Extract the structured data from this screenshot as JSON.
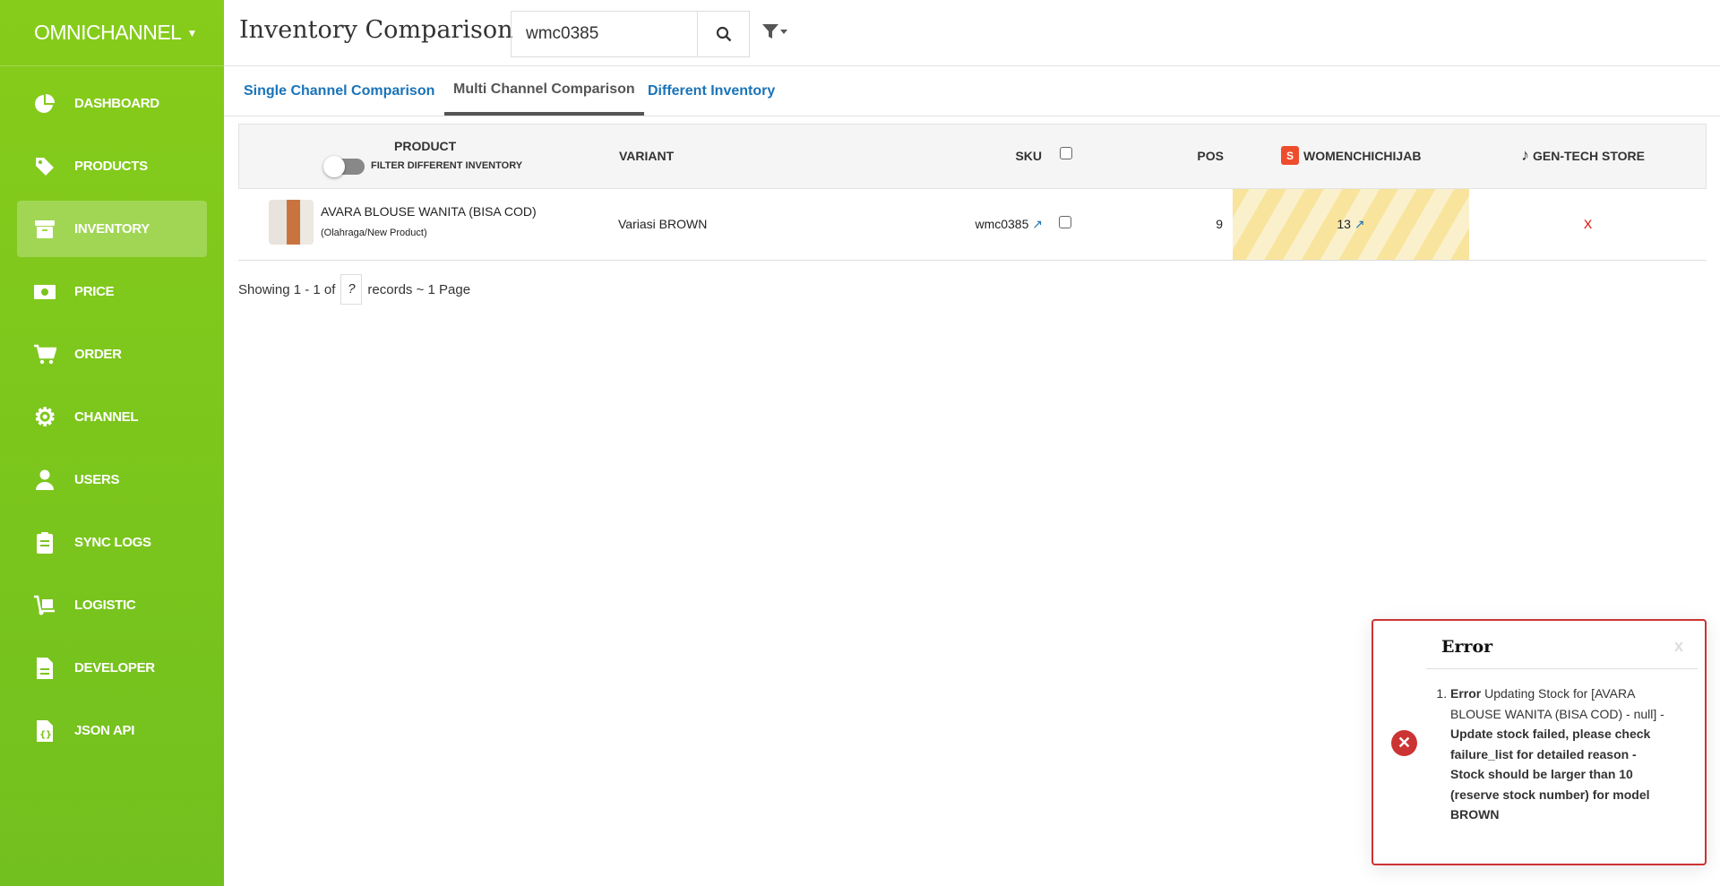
{
  "brand": {
    "label": "OMNICHANNEL"
  },
  "sidebar": {
    "items": [
      {
        "label": "DASHBOARD",
        "icon": "pie-chart-icon"
      },
      {
        "label": "PRODUCTS",
        "icon": "tag-icon"
      },
      {
        "label": "INVENTORY",
        "icon": "archive-icon",
        "active": true
      },
      {
        "label": "PRICE",
        "icon": "money-icon"
      },
      {
        "label": "ORDER",
        "icon": "cart-icon"
      },
      {
        "label": "CHANNEL",
        "icon": "gear-icon"
      },
      {
        "label": "USERS",
        "icon": "user-icon"
      },
      {
        "label": "SYNC LOGS",
        "icon": "clipboard-icon"
      },
      {
        "label": "LOGISTIC",
        "icon": "dolly-icon"
      },
      {
        "label": "DEVELOPER",
        "icon": "file-icon"
      },
      {
        "label": "JSON API",
        "icon": "json-file-icon"
      }
    ]
  },
  "header": {
    "title": "Inventory Comparison",
    "search_value": "wmc0385"
  },
  "tabs": [
    {
      "label": "Single Channel Comparison"
    },
    {
      "label": "Multi Channel Comparison",
      "active": true
    },
    {
      "label": "Different Inventory"
    }
  ],
  "table": {
    "headers": {
      "product": "PRODUCT",
      "filter_label": "FILTER DIFFERENT INVENTORY",
      "variant": "VARIANT",
      "sku": "SKU",
      "pos": "POS",
      "channel1": "WOMENCHICHIJAB",
      "channel2": "GEN-TECH STORE"
    },
    "rows": [
      {
        "name": "AVARA BLOUSE WANITA (BISA COD)",
        "category": "(Olahraga/New Product)",
        "variant": "Variasi BROWN",
        "sku": "wmc0385",
        "pos": "9",
        "channel1": "13",
        "channel2": "X"
      }
    ]
  },
  "footer": {
    "prefix": "Showing 1 - 1 of",
    "total": "?",
    "suffix": "records ~ 1 Page"
  },
  "error": {
    "title": "Error",
    "close": "x",
    "strong": "Error",
    "text": " Updating Stock for [AVARA BLOUSE WANITA (BISA COD) - null] - ",
    "bold": "Update stock failed, please check failure_list for detailed reason - Stock should be larger than 10 (reserve stock number) for model BROWN"
  },
  "colors": {
    "sidebar": "#7cc41d",
    "link": "#1a73b8",
    "error": "#cc3333",
    "missing": "#e00000"
  }
}
